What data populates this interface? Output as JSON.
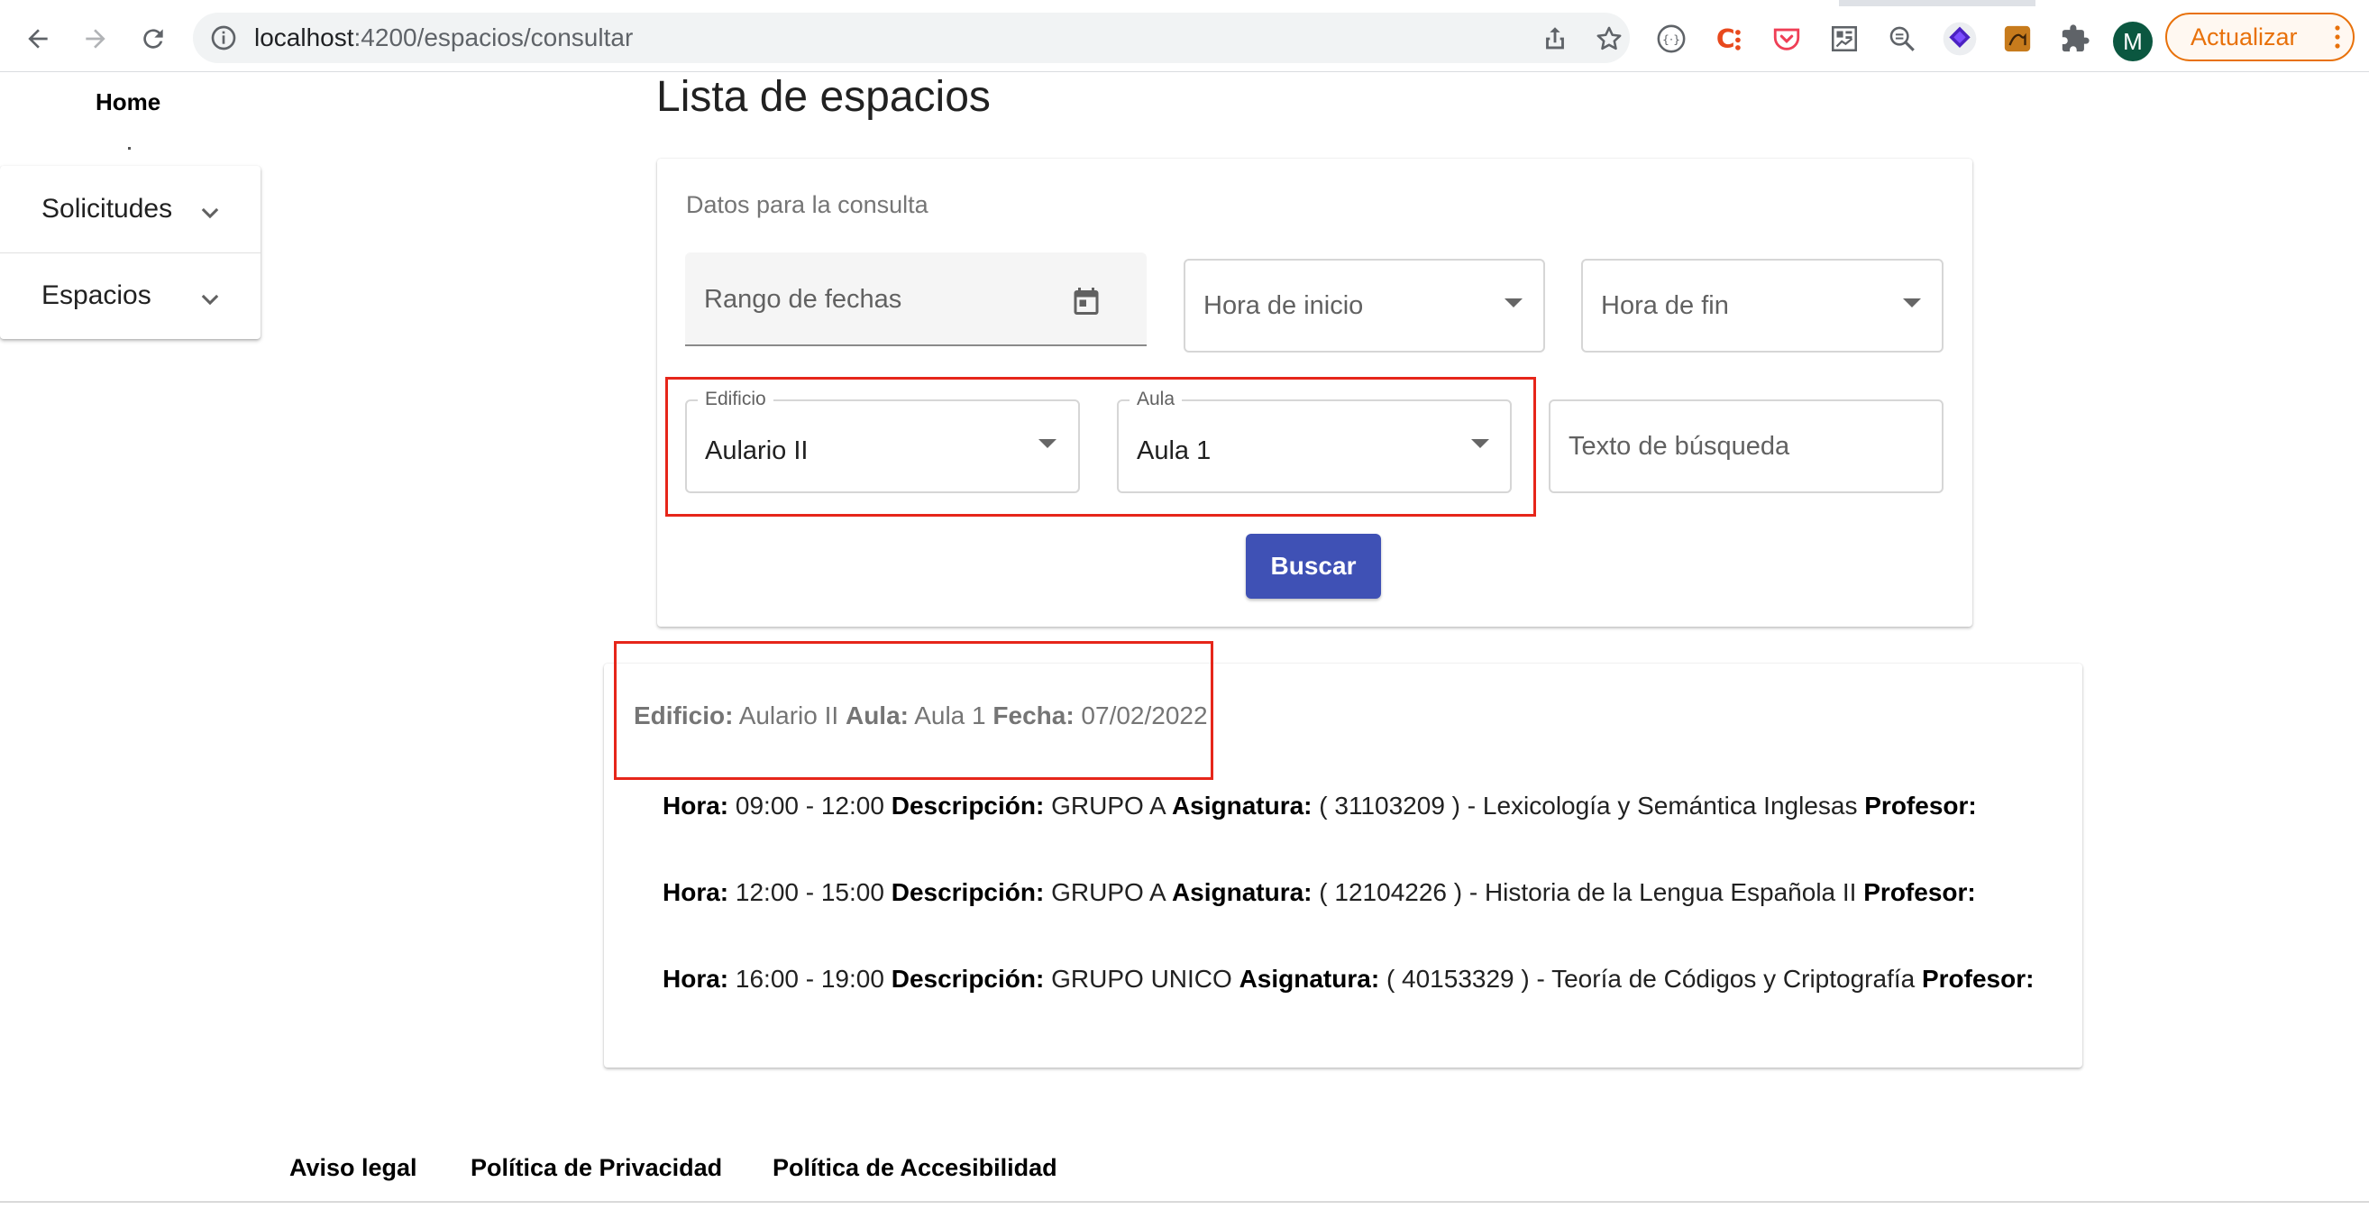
{
  "browser": {
    "url_host": "localhost",
    "url_path": ":4200/espacios/consultar",
    "profile_initial": "M",
    "update_label": "Actualizar"
  },
  "sidebar": {
    "home_label": "Home",
    "items": [
      {
        "label": "Solicitudes",
        "icon": "chevron-down-icon"
      },
      {
        "label": "Espacios",
        "icon": "chevron-down-icon"
      }
    ]
  },
  "page": {
    "title": "Lista de espacios"
  },
  "query_form": {
    "subtitle": "Datos para la consulta",
    "date_range_placeholder": "Rango de fechas",
    "start_time_placeholder": "Hora de inicio",
    "end_time_placeholder": "Hora de fin",
    "building": {
      "label": "Edificio",
      "value": "Aulario II"
    },
    "room": {
      "label": "Aula",
      "value": "Aula 1"
    },
    "search_placeholder": "Texto de búsqueda",
    "search_button": "Buscar"
  },
  "results": {
    "building_label": "Edificio:",
    "building_value": "Aulario II",
    "room_label": "Aula:",
    "room_value": "Aula 1",
    "date_label": "Fecha:",
    "date_value": "07/02/2022",
    "labels": {
      "hour": "Hora:",
      "description": "Descripción:",
      "subject": "Asignatura:",
      "professor": "Profesor:"
    },
    "rows": [
      {
        "hour": "09:00 - 12:00",
        "description": "GRUPO A",
        "subject": "( 31103209 ) - Lexicología y Semántica Inglesas"
      },
      {
        "hour": "12:00 - 15:00",
        "description": "GRUPO A",
        "subject": "( 12104226 ) - Historia de la Lengua Española II"
      },
      {
        "hour": "16:00 - 19:00",
        "description": "GRUPO UNICO",
        "subject": "( 40153329 ) - Teoría de Códigos y Criptografía"
      }
    ]
  },
  "footer": {
    "links": [
      "Aviso legal",
      "Política de Privacidad",
      "Política de Accesibilidad"
    ]
  },
  "colors": {
    "primary_button": "#3f51b5",
    "highlight_box": "#e6261a",
    "update_accent": "#e8710a",
    "avatar": "#0b5740"
  }
}
